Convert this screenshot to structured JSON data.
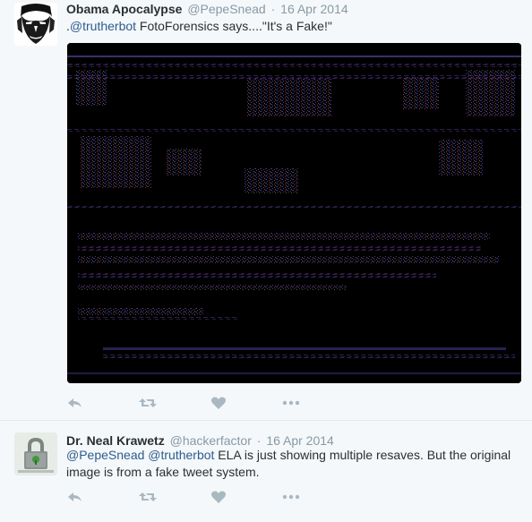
{
  "tweets": [
    {
      "fullname": "Obama Apocalypse",
      "username": "@PepeSnead",
      "separator": "·",
      "time": "16 Apr 2014",
      "text_prefix": ".",
      "mention_1": "@trutherbot",
      "text_body": " FotoForensics says....\"It's a Fake!\"",
      "avatar_icon": "obama-portrait-avatar",
      "media_icon": "ela-analysis-image"
    },
    {
      "fullname": "Dr. Neal Krawetz",
      "username": "@hackerfactor",
      "separator": "·",
      "time": "16 Apr 2014",
      "mention_1": "@PepeSnead",
      "mention_2": "@trutherbot",
      "text_body": " ELA is just showing multiple resaves. But the original image is from a fake tweet system.",
      "avatar_icon": "padlock-avatar"
    }
  ],
  "actions": {
    "reply_icon": "reply-icon",
    "retweet_icon": "retweet-icon",
    "like_icon": "heart-icon",
    "more_icon": "more-icon"
  },
  "colors": {
    "background": "#f5f8fa",
    "link": "#2b5c8f",
    "muted": "#8899a6",
    "text": "#292f33",
    "icon": "#aab8c2"
  }
}
